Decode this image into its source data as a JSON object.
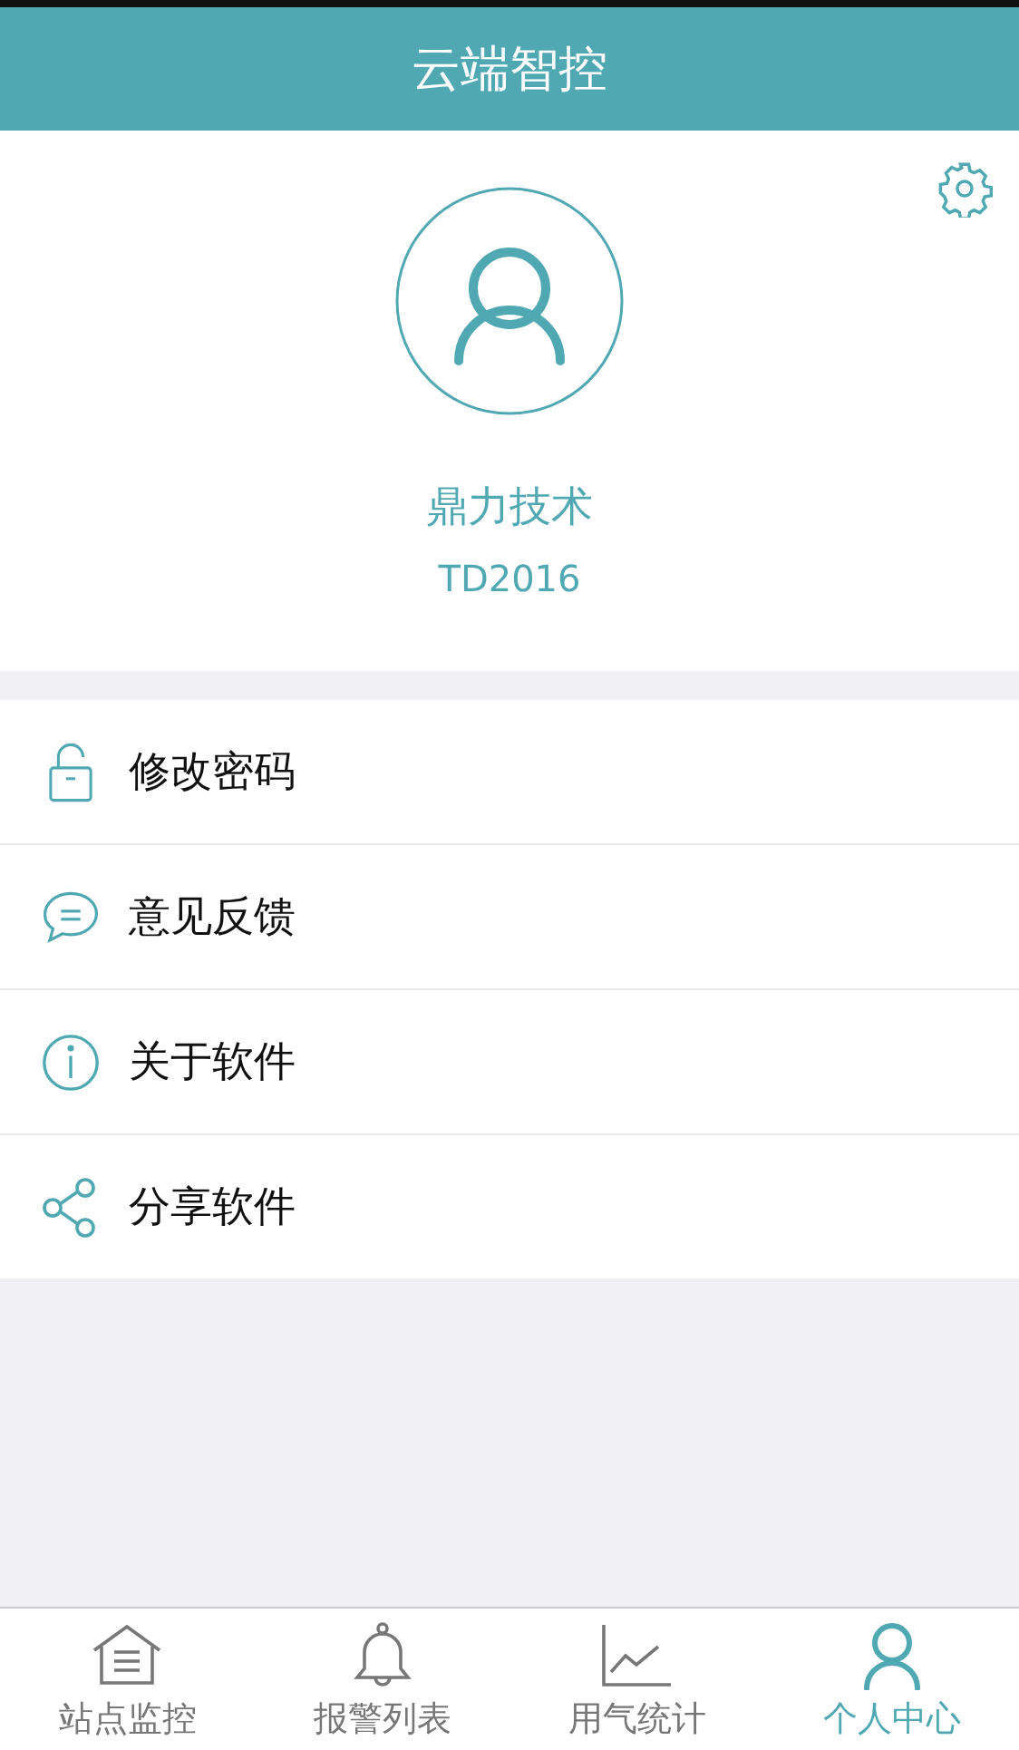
{
  "header": {
    "title": "云端智控"
  },
  "profile": {
    "name": "鼎力技术",
    "account": "TD2016"
  },
  "menu": [
    {
      "kind": "lock",
      "label": "修改密码"
    },
    {
      "kind": "chat",
      "label": "意见反馈"
    },
    {
      "kind": "info",
      "label": "关于软件"
    },
    {
      "kind": "share",
      "label": "分享软件"
    }
  ],
  "tabs": [
    {
      "kind": "home",
      "label": "站点监控",
      "selected": false
    },
    {
      "kind": "bell",
      "label": "报警列表",
      "selected": false
    },
    {
      "kind": "chart",
      "label": "用气统计",
      "selected": false
    },
    {
      "kind": "person",
      "label": "个人中心",
      "selected": true
    }
  ]
}
